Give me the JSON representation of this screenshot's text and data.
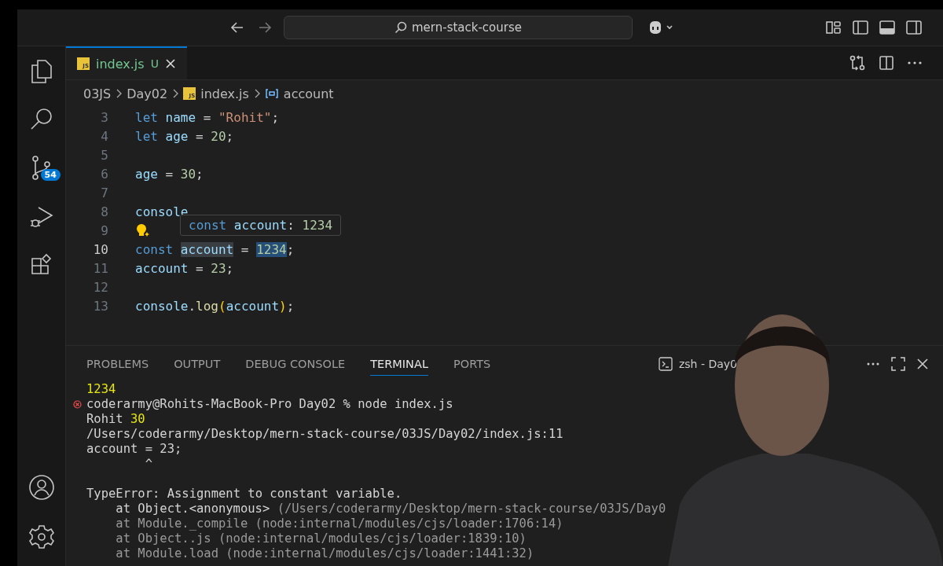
{
  "title_bar": {
    "search": "mern-stack-course"
  },
  "activity_bar": {
    "source_control_badge": "54"
  },
  "tabs": [
    {
      "label": "index.js",
      "icon_text": "JS",
      "status": "U",
      "selected": true
    }
  ],
  "breadcrumb": [
    {
      "label": "03JS",
      "kind": "folder"
    },
    {
      "label": "Day02",
      "kind": "folder"
    },
    {
      "label": "index.js",
      "kind": "file",
      "icon_text": "JS"
    },
    {
      "label": "account",
      "kind": "symbol"
    }
  ],
  "editor": {
    "lines": [
      {
        "number": "3",
        "current": false,
        "lightbulb": false,
        "tokens": [
          {
            "t": "let",
            "kind": "keyword"
          },
          {
            "t": " name",
            "kind": "variable"
          },
          {
            "t": " = ",
            "kind": "punct"
          },
          {
            "t": "\"Rohit\"",
            "kind": "string"
          },
          {
            "t": ";",
            "kind": "punct"
          }
        ]
      },
      {
        "number": "4",
        "current": false,
        "lightbulb": false,
        "tokens": [
          {
            "t": "let",
            "kind": "keyword"
          },
          {
            "t": " age",
            "kind": "variable"
          },
          {
            "t": " = ",
            "kind": "punct"
          },
          {
            "t": "20",
            "kind": "number"
          },
          {
            "t": ";",
            "kind": "punct"
          }
        ]
      },
      {
        "number": "5",
        "current": false,
        "lightbulb": false
      },
      {
        "number": "6",
        "current": false,
        "lightbulb": false,
        "tokens": [
          {
            "t": "age",
            "kind": "variable"
          },
          {
            "t": " = ",
            "kind": "punct"
          },
          {
            "t": "30",
            "kind": "number"
          },
          {
            "t": ";",
            "kind": "punct"
          }
        ]
      },
      {
        "number": "7",
        "current": false,
        "lightbulb": false
      },
      {
        "number": "8",
        "current": false,
        "lightbulb": false,
        "tokens": [
          {
            "t": "console",
            "kind": "variable"
          }
        ]
      },
      {
        "number": "9",
        "current": false,
        "lightbulb": true
      },
      {
        "number": "10",
        "current": true,
        "lightbulb": false,
        "tokens": [
          {
            "t": "const ",
            "kind": "keyword"
          },
          {
            "t": "account",
            "kind": "variable",
            "highlighted": true
          },
          {
            "t": " = ",
            "kind": "punct"
          },
          {
            "t": "1234",
            "kind": "number",
            "selected": true
          },
          {
            "t": ";",
            "kind": "punct"
          }
        ]
      },
      {
        "number": "11",
        "current": false,
        "lightbulb": false,
        "tokens": [
          {
            "t": "account",
            "kind": "variable"
          },
          {
            "t": " = ",
            "kind": "punct"
          },
          {
            "t": "23",
            "kind": "number"
          },
          {
            "t": ";",
            "kind": "punct"
          }
        ]
      },
      {
        "number": "12",
        "current": false,
        "lightbulb": false
      },
      {
        "number": "13",
        "current": false,
        "lightbulb": false,
        "tokens": [
          {
            "t": "console",
            "kind": "variable"
          },
          {
            "t": ".",
            "kind": "punct"
          },
          {
            "t": "log",
            "kind": "function"
          },
          {
            "t": "(",
            "kind": "bracket"
          },
          {
            "t": "account",
            "kind": "variable"
          },
          {
            "t": ")",
            "kind": "bracket"
          },
          {
            "t": ";",
            "kind": "punct"
          }
        ]
      }
    ],
    "hover": [
      {
        "t": "const ",
        "kind": "keyword"
      },
      {
        "t": "account",
        "kind": "variable"
      },
      {
        "t": ": ",
        "kind": "punct"
      },
      {
        "t": "1234",
        "kind": "number"
      }
    ]
  },
  "panel": {
    "tabs": [
      {
        "label": "PROBLEMS",
        "selected": false
      },
      {
        "label": "OUTPUT",
        "selected": false
      },
      {
        "label": "DEBUG CONSOLE",
        "selected": false
      },
      {
        "label": "TERMINAL",
        "selected": true
      },
      {
        "label": "PORTS",
        "selected": false
      }
    ],
    "terminal_name": "zsh - Day0",
    "terminal": [
      {
        "kind": "normal",
        "error": false,
        "segments": [
          {
            "t": "1234",
            "kind": "yellow"
          }
        ]
      },
      {
        "kind": "normal",
        "error": true,
        "segments": [
          {
            "t": "coderarmy@Rohits-MacBook-Pro Day02 % node index.js",
            "kind": "text"
          }
        ]
      },
      {
        "kind": "normal",
        "error": false,
        "segments": [
          {
            "t": "Rohit ",
            "kind": "text"
          },
          {
            "t": "30",
            "kind": "yellow"
          }
        ]
      },
      {
        "kind": "normal",
        "error": false,
        "segments": [
          {
            "t": "/Users/coderarmy/Desktop/mern-stack-course/03JS/Day02/index.js:11",
            "kind": "text"
          }
        ]
      },
      {
        "kind": "normal",
        "error": false,
        "segments": [
          {
            "t": "account = 23;",
            "kind": "text"
          }
        ]
      },
      {
        "kind": "caret",
        "error": false,
        "segments": [
          {
            "t": "^",
            "kind": "text"
          }
        ]
      },
      {
        "kind": "blank",
        "error": false
      },
      {
        "kind": "normal",
        "error": false,
        "segments": [
          {
            "t": "TypeError: Assignment to constant variable.",
            "kind": "text"
          }
        ]
      },
      {
        "kind": "stack",
        "error": false,
        "segments": [
          {
            "t": "at Object.<anonymous> ",
            "kind": "text"
          },
          {
            "t": "(/Users/coderarmy/Desktop/mern-stack-course/03JS/Day0",
            "kind": "dim"
          }
        ]
      },
      {
        "kind": "stack",
        "error": false,
        "segments": [
          {
            "t": "at Module._compile (node:internal/modules/cjs/loader:1706:14)",
            "kind": "dim"
          }
        ]
      },
      {
        "kind": "stack",
        "error": false,
        "segments": [
          {
            "t": "at Object..js (node:internal/modules/cjs/loader:1839:10)",
            "kind": "dim"
          }
        ]
      },
      {
        "kind": "stack",
        "error": false,
        "segments": [
          {
            "t": "at Module.load (node:internal/modules/cjs/loader:1441:32)",
            "kind": "dim"
          }
        ]
      }
    ]
  }
}
